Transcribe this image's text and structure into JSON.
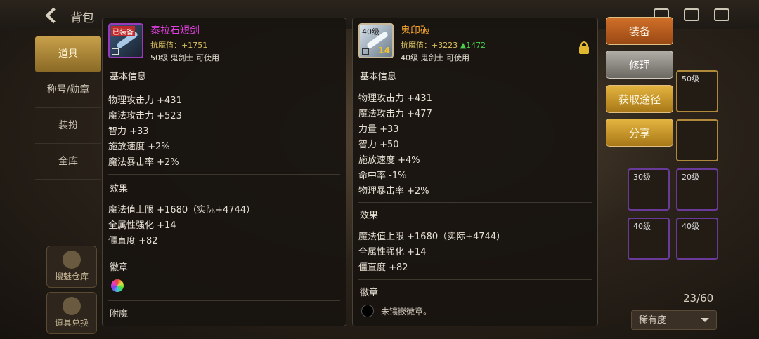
{
  "header": {
    "title": "背包"
  },
  "nav": {
    "items": [
      {
        "label": "道具",
        "active": true
      },
      {
        "label": "称号/勋章",
        "active": false
      },
      {
        "label": "装扮",
        "active": false
      },
      {
        "label": "全库",
        "active": false
      }
    ],
    "side_buttons": [
      "搜魅仓库",
      "道具兑换"
    ]
  },
  "inventory": {
    "count": "23/60",
    "sort_label": "稀有度",
    "slot_levels": [
      "50级",
      "30级",
      "20级",
      "40级",
      "40级"
    ]
  },
  "item_left": {
    "icon_badge": "已装备",
    "name": "泰拉石短剑",
    "name_color": "#e040e0",
    "magic_resist_label": "抗魔值：",
    "magic_resist_value": "+1751",
    "requirement": "50级 鬼剑士 可使用",
    "sections": {
      "basic": "基本信息",
      "effect": "效果",
      "emblem": "徽章",
      "enchant": "附魔"
    },
    "basic_stats": [
      "物理攻击力 +431",
      "魔法攻击力 +523",
      "智力 +33",
      "施放速度 +2%",
      "魔法暴击率 +2%"
    ],
    "effects": [
      "魔法值上限 +1680（实际+4744）",
      "全属性强化 +14",
      "僵直度 +82"
    ]
  },
  "item_right": {
    "icon_level": "40级",
    "icon_number": "14",
    "name": "鬼印破",
    "name_color": "#f0a030",
    "magic_resist_label": "抗魔值：",
    "magic_resist_value": "+3223",
    "magic_resist_diff": "▲1472",
    "requirement": "40级 鬼剑士 可使用",
    "sections": {
      "basic": "基本信息",
      "effect": "效果",
      "emblem": "徽章"
    },
    "basic_stats": [
      "物理攻击力 +431",
      "魔法攻击力 +477",
      "力量 +33",
      "智力 +50",
      "施放速度 +4%",
      "命中率 -1%",
      "物理暴击率 +2%"
    ],
    "effects": [
      "魔法值上限 +1680（实际+4744）",
      "全属性强化 +14",
      "僵直度 +82"
    ],
    "emblem_text": "未镶嵌徽章。"
  },
  "actions": {
    "equip": "装备",
    "repair": "修理",
    "source": "获取途径",
    "share": "分享"
  }
}
